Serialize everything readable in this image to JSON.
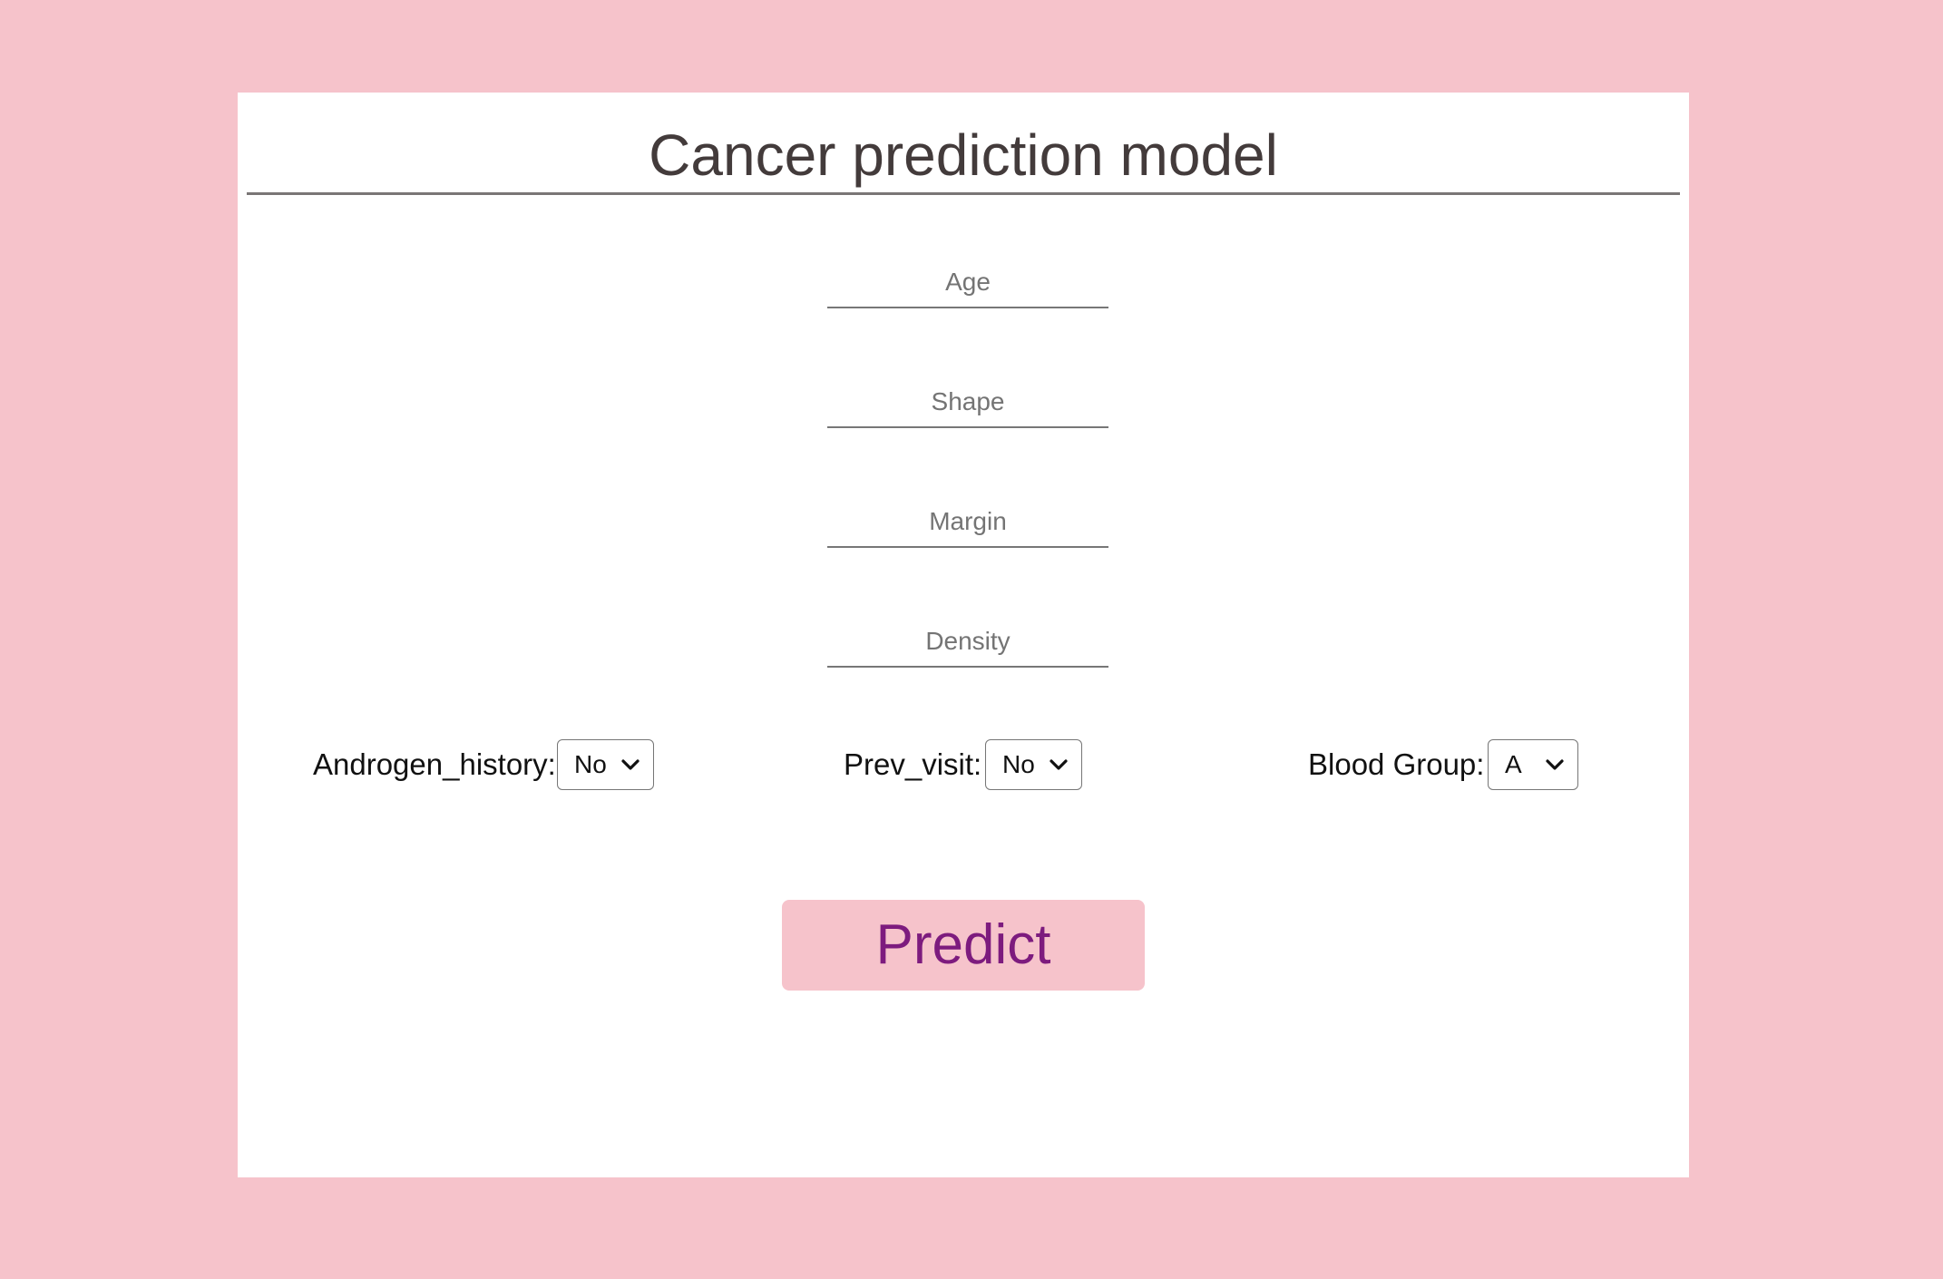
{
  "header": {
    "title": "Cancer prediction model"
  },
  "form": {
    "fields": [
      {
        "placeholder": "Age",
        "value": ""
      },
      {
        "placeholder": "Shape",
        "value": ""
      },
      {
        "placeholder": "Margin",
        "value": ""
      },
      {
        "placeholder": "Density",
        "value": ""
      }
    ],
    "selects": [
      {
        "label": "Androgen_history:",
        "value": "No"
      },
      {
        "label": "Prev_visit:",
        "value": "No"
      },
      {
        "label": "Blood Group:",
        "value": "A"
      }
    ],
    "submit_label": "Predict"
  },
  "colors": {
    "background": "#f6c3cb",
    "card": "#ffffff",
    "button_text": "#7d1b7e",
    "title_text": "#433b3b"
  },
  "icons": {
    "select_indicator": "chevron-down-icon"
  }
}
